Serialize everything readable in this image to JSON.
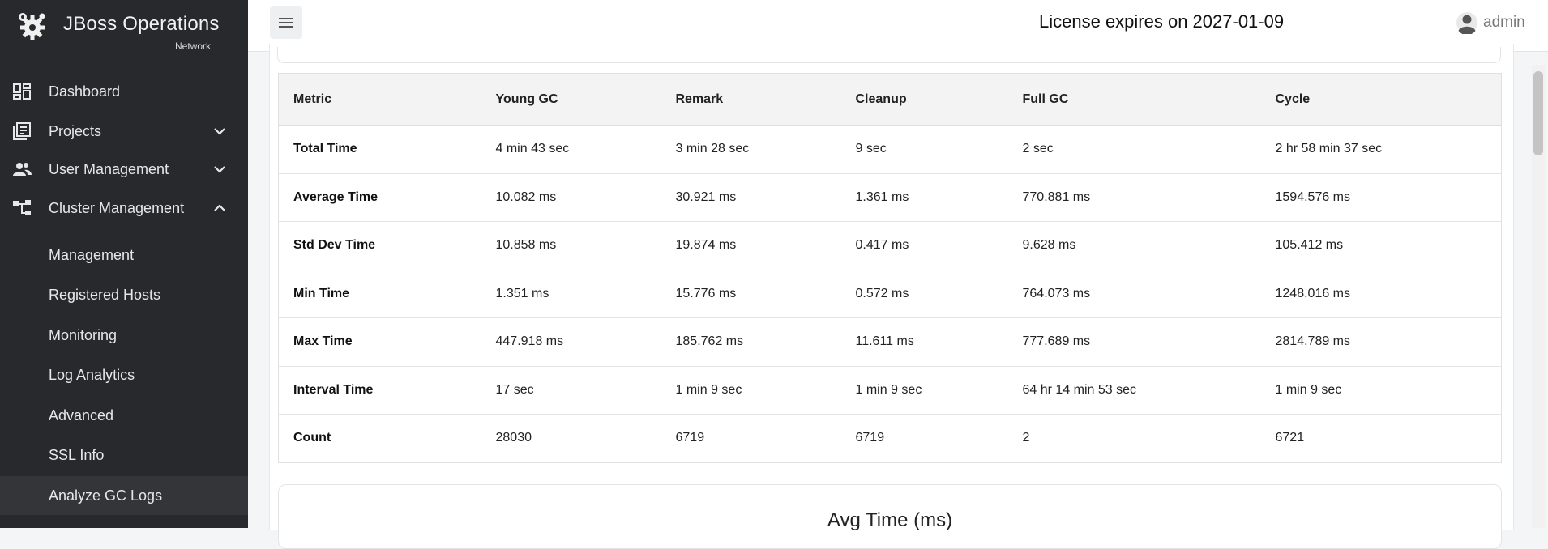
{
  "brand": {
    "title": "JBoss Operations",
    "subtitle": "Network"
  },
  "nav": {
    "dashboard": "Dashboard",
    "projects": "Projects",
    "user_management": "User Management",
    "cluster_management": "Cluster Management",
    "sub": {
      "management": "Management",
      "registered_hosts": "Registered Hosts",
      "monitoring": "Monitoring",
      "log_analytics": "Log Analytics",
      "advanced": "Advanced",
      "ssl_info": "SSL Info",
      "analyze_gc_logs": "Analyze GC Logs"
    }
  },
  "topbar": {
    "license": "License expires on 2027-01-09",
    "user": "admin"
  },
  "table": {
    "headers": [
      "Metric",
      "Young GC",
      "Remark",
      "Cleanup",
      "Full GC",
      "Cycle"
    ],
    "rows": [
      [
        "Total Time",
        "4 min 43 sec",
        "3 min 28 sec",
        "9 sec",
        "2 sec",
        "2 hr 58 min 37 sec"
      ],
      [
        "Average Time",
        "10.082 ms",
        "30.921 ms",
        "1.361 ms",
        "770.881 ms",
        "1594.576 ms"
      ],
      [
        "Std Dev Time",
        "10.858 ms",
        "19.874 ms",
        "0.417 ms",
        "9.628 ms",
        "105.412 ms"
      ],
      [
        "Min Time",
        "1.351 ms",
        "15.776 ms",
        "0.572 ms",
        "764.073 ms",
        "1248.016 ms"
      ],
      [
        "Max Time",
        "447.918 ms",
        "185.762 ms",
        "11.611 ms",
        "777.689 ms",
        "2814.789 ms"
      ],
      [
        "Interval Time",
        "17 sec",
        "1 min 9 sec",
        "1 min 9 sec",
        "64 hr 14 min 53 sec",
        "1 min 9 sec"
      ],
      [
        "Count",
        "28030",
        "6719",
        "6719",
        "2",
        "6721"
      ]
    ]
  },
  "chart": {
    "title": "Avg Time (ms)"
  },
  "colors": {
    "sidebar_bg": "#27292c",
    "active_item_bg": "#333539",
    "header_bg": "#f3f3f3"
  }
}
